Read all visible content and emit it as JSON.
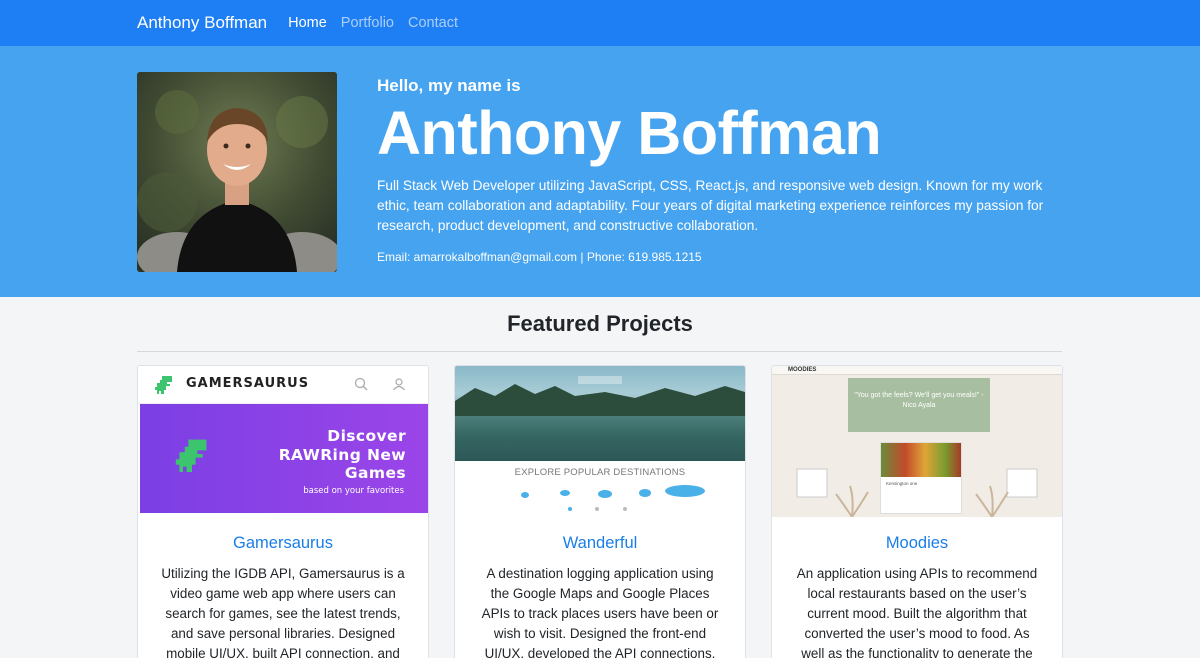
{
  "nav": {
    "brand": "Anthony Boffman",
    "links": [
      {
        "label": "Home",
        "active": true
      },
      {
        "label": "Portfolio",
        "active": false
      },
      {
        "label": "Contact",
        "active": false
      }
    ]
  },
  "hero": {
    "greeting": "Hello, my name is",
    "name": "Anthony Boffman",
    "bio": "Full Stack Web Developer utilizing JavaScript, CSS, React.js, and responsive web design. Known for my work ethic, team collaboration and adaptability. Four years of digital marketing experience reinforces my passion for research, product development, and constructive collaboration.",
    "contact": "Email: amarrokalboffman@gmail.com | Phone: 619.985.1215"
  },
  "projects": {
    "title": "Featured Projects",
    "items": [
      {
        "name": "Gamersaurus",
        "description": "Utilizing the IGDB API, Gamersaurus is a video game web app where users can search for games, see the latest trends, and save personal libraries. Designed mobile UI/UX, built API connection, and",
        "screenshot": {
          "logo_text": "GAMERSAURUS",
          "headline": "Discover RAWRing New Games",
          "subline": "based on your favorites"
        }
      },
      {
        "name": "Wanderful",
        "description": "A destination logging application using the Google Maps and Google Places APIs to track places users have been or wish to visit. Designed the front-end UI/UX, developed the API connections,",
        "screenshot": {
          "banner_text": "EXPLORE POPULAR DESTINATIONS"
        }
      },
      {
        "name": "Moodies",
        "description": "An application using APIs to recommend local restaurants based on the user’s current mood. Built the algorithm that converted the user’s mood to food. As well as the functionality to generate the",
        "screenshot": {
          "brand": "MOODIES",
          "quote": "\"You got the feels? We'll get you meals!\" -Nico Ayala",
          "card_title": "Kensington one"
        }
      }
    ]
  },
  "colors": {
    "nav_bg": "#1e7ef3",
    "hero_bg": "#45a3ef",
    "link": "#1a7ee8",
    "page_bg": "#f4f5f7"
  }
}
